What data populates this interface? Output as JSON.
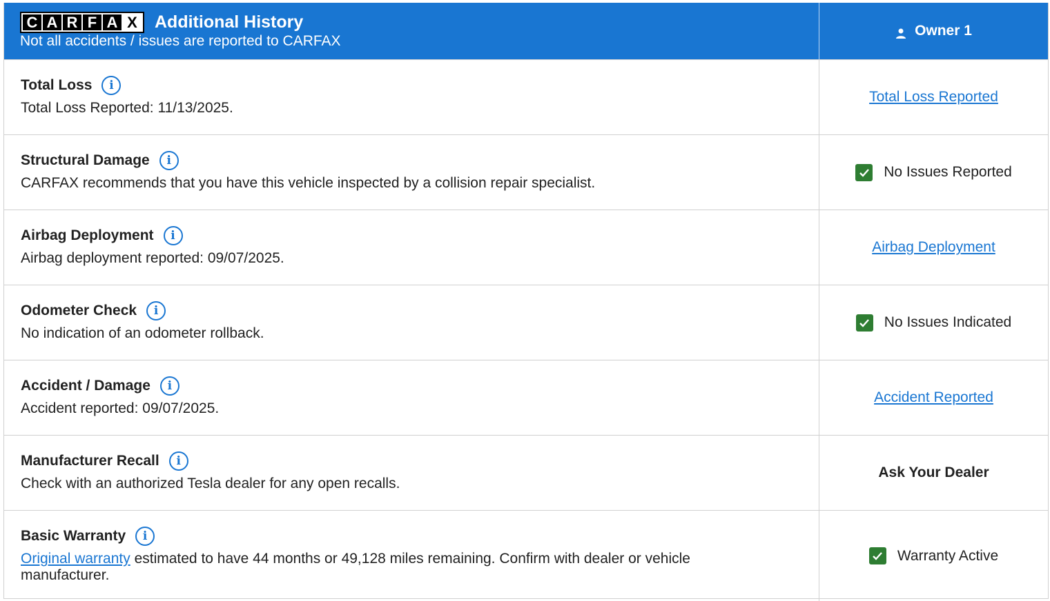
{
  "header": {
    "logo_letters": [
      "C",
      "A",
      "R",
      "F",
      "A",
      "X"
    ],
    "title": "Additional History",
    "subtitle": "Not all accidents / issues are reported to CARFAX",
    "owner_label": "Owner 1",
    "colors": {
      "header_bg": "#1976d2",
      "link": "#1976d2",
      "check_bg": "#2e7d32"
    }
  },
  "rows": [
    {
      "title": "Total Loss",
      "description": "Total Loss Reported: 11/13/2025.",
      "status": "Total Loss Reported"
    },
    {
      "title": "Structural Damage",
      "description": "CARFAX recommends that you have this vehicle inspected by a collision repair specialist.",
      "status": "No Issues Reported"
    },
    {
      "title": "Airbag Deployment",
      "description": "Airbag deployment reported: 09/07/2025.",
      "status": "Airbag Deployment"
    },
    {
      "title": "Odometer Check",
      "description": "No indication of an odometer rollback.",
      "status": "No Issues Indicated"
    },
    {
      "title": "Accident / Damage",
      "description": "Accident reported: 09/07/2025.",
      "status": "Accident Reported"
    },
    {
      "title": "Manufacturer Recall",
      "description": "Check with an authorized Tesla dealer for any open recalls.",
      "status": "Ask Your Dealer"
    },
    {
      "title": "Basic Warranty",
      "description_link": "Original warranty",
      "description": " estimated to have 44 months or 49,128 miles remaining. Confirm with dealer or vehicle manufacturer.",
      "status": "Warranty Active"
    }
  ]
}
